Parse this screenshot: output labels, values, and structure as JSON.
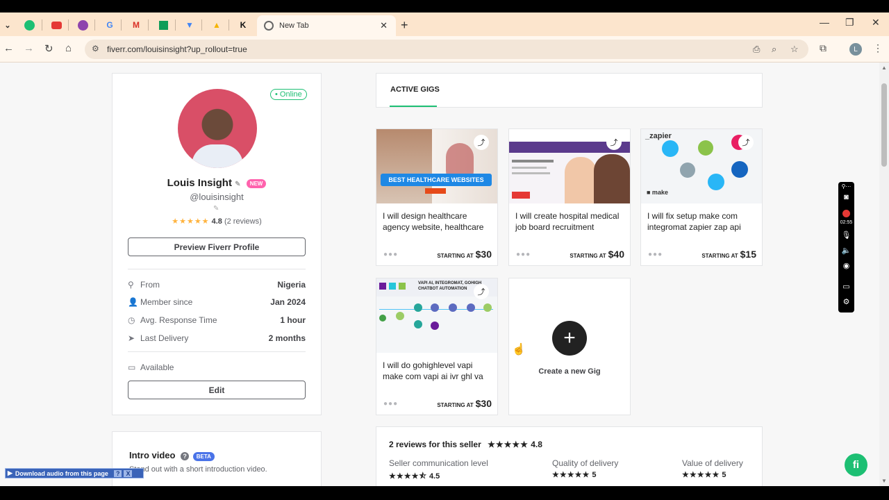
{
  "browser": {
    "tab_title": "New Tab",
    "url": "fiverr.com/louisinsight?up_rollout=true",
    "tab_icons": [
      "fiverr-icon",
      "youtube-icon",
      "app-icon",
      "google-icon",
      "gmail-icon",
      "sheets-icon",
      "flow-icon",
      "drive-icon",
      "k-icon"
    ]
  },
  "profile": {
    "online_label": "• Online",
    "name": "Louis Insight",
    "new_badge": "NEW",
    "handle": "@louisinsight",
    "rating": "4.8",
    "reviews": "(2 reviews)",
    "preview_button": "Preview Fiverr Profile",
    "info": [
      {
        "label": "From",
        "value": "Nigeria"
      },
      {
        "label": "Member since",
        "value": "Jan 2024"
      },
      {
        "label": "Avg. Response Time",
        "value": "1 hour"
      },
      {
        "label": "Last Delivery",
        "value": "2 months"
      }
    ],
    "available_label": "Available",
    "edit_button": "Edit"
  },
  "intro": {
    "title": "Intro video",
    "badge": "BETA",
    "text": "Stand out with a short introduction video."
  },
  "gigs": {
    "tab_label": "ACTIVE GIGS",
    "starting_at": "STARTING AT",
    "items": [
      {
        "title": "I will design healthcare agency website, healthcare",
        "price": "$30",
        "thumb_text": "BEST HEALTHCARE WEBSITES"
      },
      {
        "title": "I will create hospital medical job board recruitment",
        "price": "$40"
      },
      {
        "title": "I will fix setup make com integromat zapier zap api",
        "price": "$15"
      },
      {
        "title": "I will do gohighlevel vapi make com vapi ai ivr ghl va",
        "price": "$30",
        "thumb_text": "VAPI AI, INTEGROMAT, GOHIGH CHATBOT AUTOMATION"
      }
    ],
    "create_label": "Create a new Gig"
  },
  "reviews": {
    "title": "2 reviews for this seller",
    "rating": "4.8",
    "columns": [
      {
        "label": "Seller communication level",
        "value": "4.5"
      },
      {
        "label": "Quality of delivery",
        "value": "5"
      },
      {
        "label": "Value of delivery",
        "value": "5"
      }
    ]
  },
  "recorder": {
    "time": "02:55"
  },
  "download_bar": {
    "label": "Download audio from this page",
    "help": "?",
    "close": "X"
  },
  "colors": {
    "brand": "#1dbf73",
    "new_badge": "#ff62ad",
    "star": "#ffb33e"
  }
}
